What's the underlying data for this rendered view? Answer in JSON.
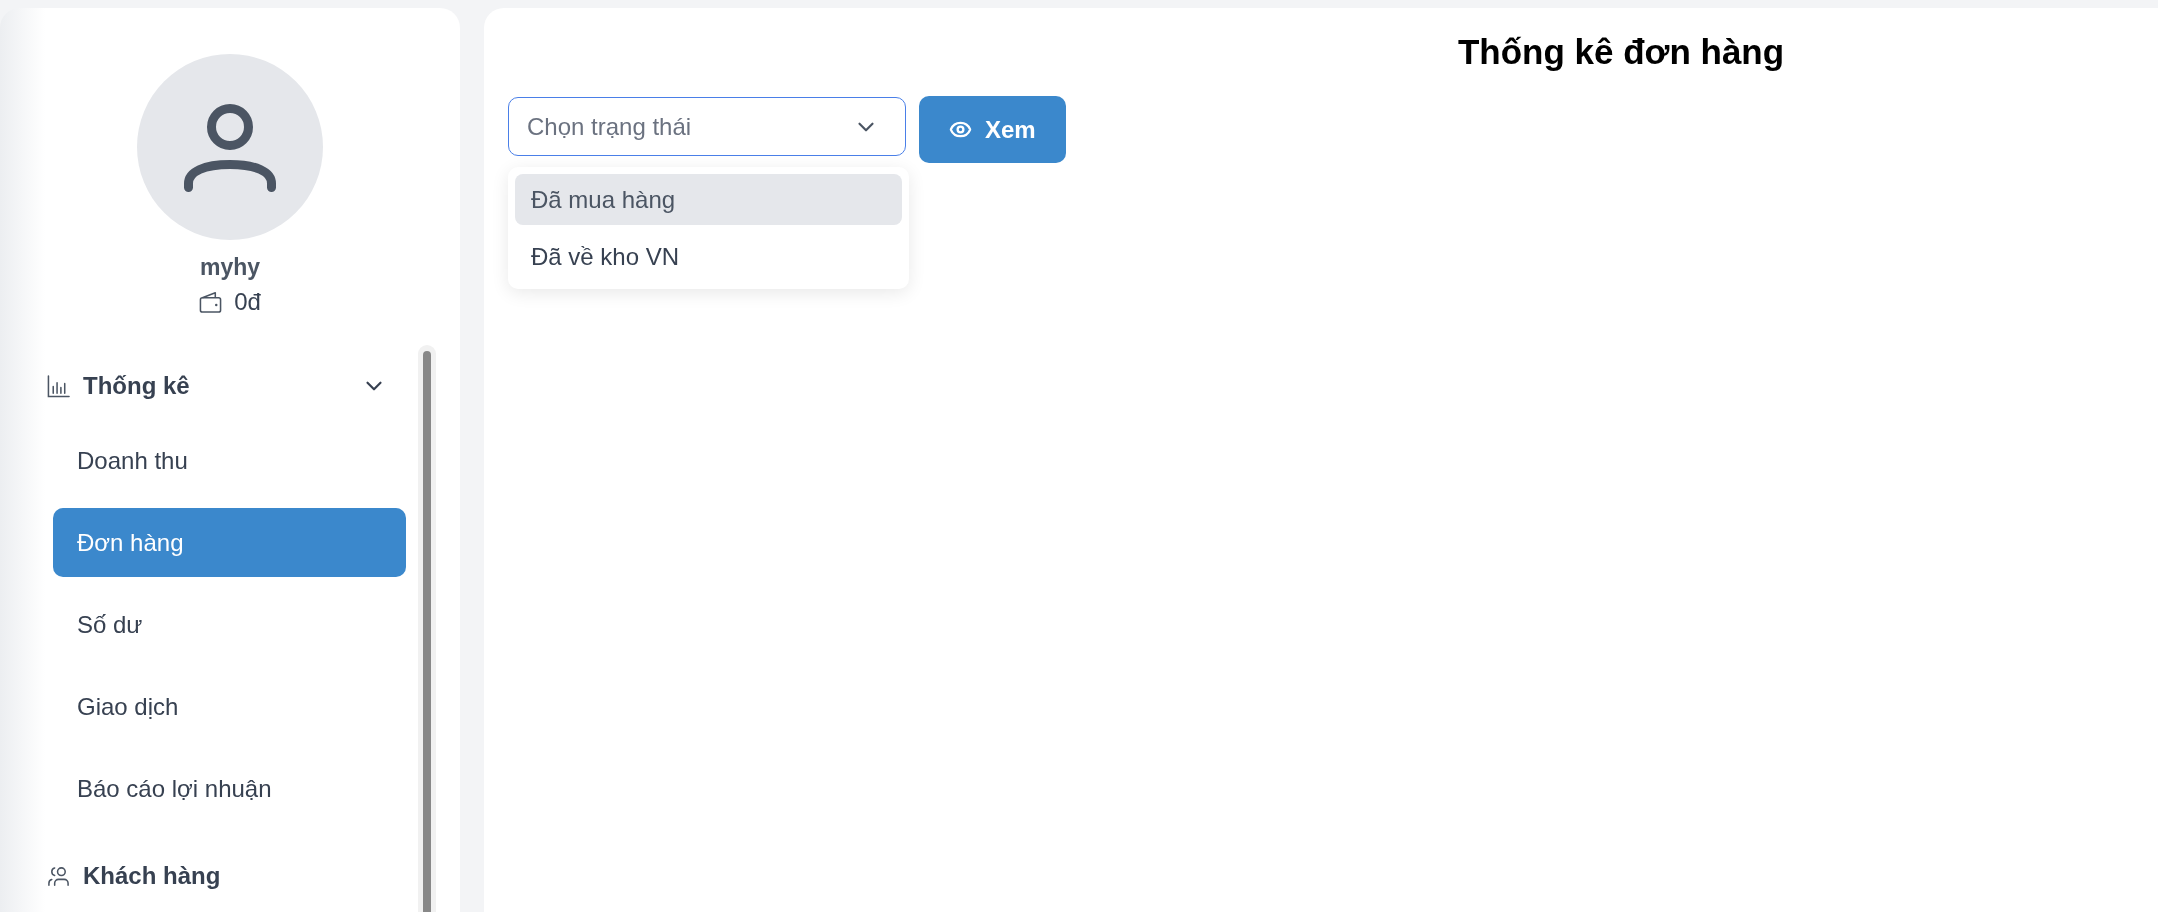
{
  "sidebar": {
    "user": {
      "name": "myhy",
      "balance": "0đ"
    },
    "menu": [
      {
        "label": "Thống kê",
        "expanded": true,
        "children": [
          {
            "label": "Doanh thu",
            "selected": false
          },
          {
            "label": "Đơn hàng",
            "selected": true
          },
          {
            "label": "Số dư",
            "selected": false
          },
          {
            "label": "Giao dịch",
            "selected": false
          },
          {
            "label": "Báo cáo lợi nhuận",
            "selected": false
          }
        ]
      },
      {
        "label": "Khách hàng"
      }
    ]
  },
  "main": {
    "title": "Thống kê đơn hàng",
    "status_select": {
      "placeholder": "Chọn trạng thái",
      "expanded": true,
      "options": [
        {
          "label": "Đã mua hàng",
          "highlighted": true
        },
        {
          "label": "Đã về kho VN",
          "highlighted": false
        }
      ]
    },
    "view_button": {
      "label": "Xem"
    }
  }
}
